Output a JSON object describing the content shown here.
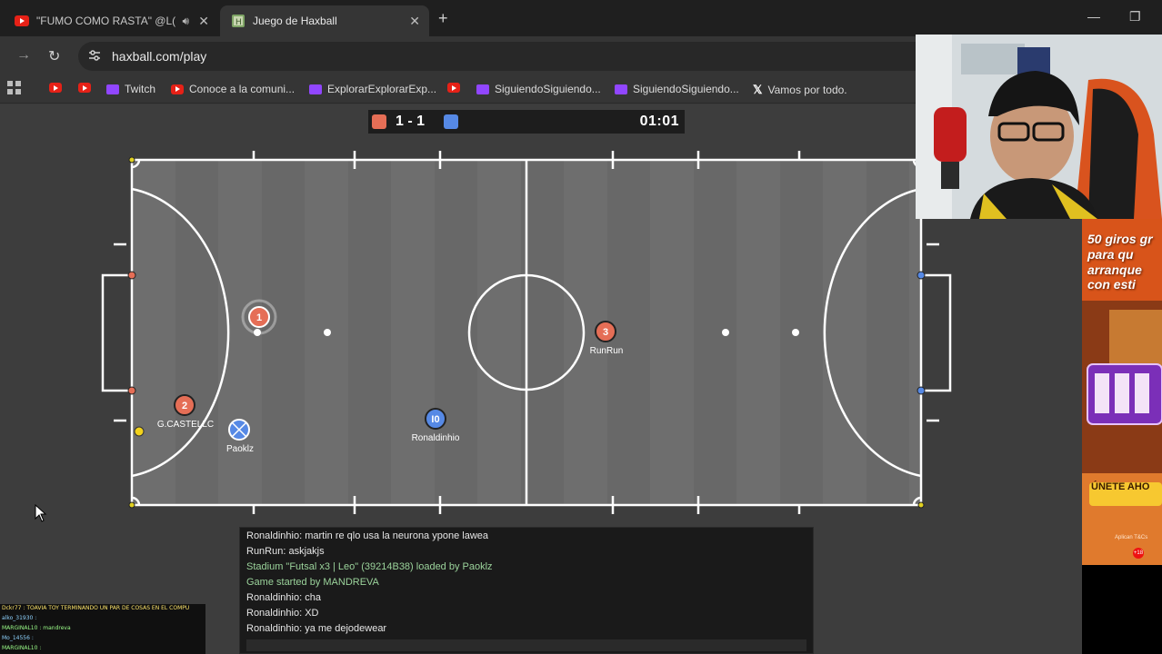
{
  "browser": {
    "tabs": [
      {
        "title": "\"FUMO COMO RASTA\" @L(",
        "favicon": "youtube-icon",
        "audio": true,
        "active": false
      },
      {
        "title": "Juego de Haxball",
        "favicon": "haxball-icon",
        "active": true
      }
    ],
    "url": "haxball.com/play",
    "bookmarks": [
      {
        "label": "",
        "icon": "youtube-icon"
      },
      {
        "label": "",
        "icon": "youtube-icon"
      },
      {
        "label": "Twitch",
        "icon": "twitch-icon"
      },
      {
        "label": "Conoce a la comuni...",
        "icon": "youtube-icon"
      },
      {
        "label": "ExplorarExplorarExp...",
        "icon": "twitch-icon"
      },
      {
        "label": "",
        "icon": "youtube-icon"
      },
      {
        "label": "SiguiendoSiguiendo...",
        "icon": "twitch-icon"
      },
      {
        "label": "SiguiendoSiguiendo...",
        "icon": "twitch-icon"
      },
      {
        "label": "Vamos por todo.",
        "icon": "x-icon"
      }
    ]
  },
  "game": {
    "score": {
      "red": 1,
      "blue": 1,
      "text": "1 - 1",
      "time": "01:01"
    },
    "colors": {
      "red": "#e56e56",
      "blue": "#5689e5",
      "pitch": "#6b6b6b",
      "lines": "#ffffff"
    },
    "players": [
      {
        "team": "red",
        "number": "1",
        "name": ""
      },
      {
        "team": "red",
        "number": "2",
        "name": "G.CASTELLC"
      },
      {
        "team": "red",
        "number": "3",
        "name": "RunRun"
      },
      {
        "team": "blue",
        "number": "",
        "name": "Paoklz"
      },
      {
        "team": "blue",
        "number": "I0",
        "name": "Ronaldinhio"
      }
    ]
  },
  "chat": {
    "lines": [
      {
        "text": "Ronaldinhio: martin re qlo usa la neurona ypone lawea",
        "type": "msg"
      },
      {
        "text": "RunRun: askjakjs",
        "type": "msg"
      },
      {
        "text": "Stadium \"Futsal x3 | Leo\" (39214B38) loaded by Paoklz",
        "type": "sys"
      },
      {
        "text": "Game started by MANDREVA",
        "type": "sys"
      },
      {
        "text": "Ronaldinhio: cha",
        "type": "msg"
      },
      {
        "text": "Ronaldinhio: XD",
        "type": "msg"
      },
      {
        "text": "Ronaldinhio: ya me dejodewear",
        "type": "msg"
      }
    ]
  },
  "stream_chat": {
    "lines": [
      "Dckr77 : TOAVIA TOY TERMINANDO UN PAR DE COSAS EN EL COMPU",
      "alko_31930 :",
      "MARGINAL10 : mandreva",
      "Mo_14556 :",
      "MARGINAL10 :"
    ]
  },
  "ad": {
    "headline": "50 giros gr para qu arranque con esti",
    "button": "ÚNETE AHO",
    "terms": "Aplican T&Cs",
    "age": "+18"
  }
}
